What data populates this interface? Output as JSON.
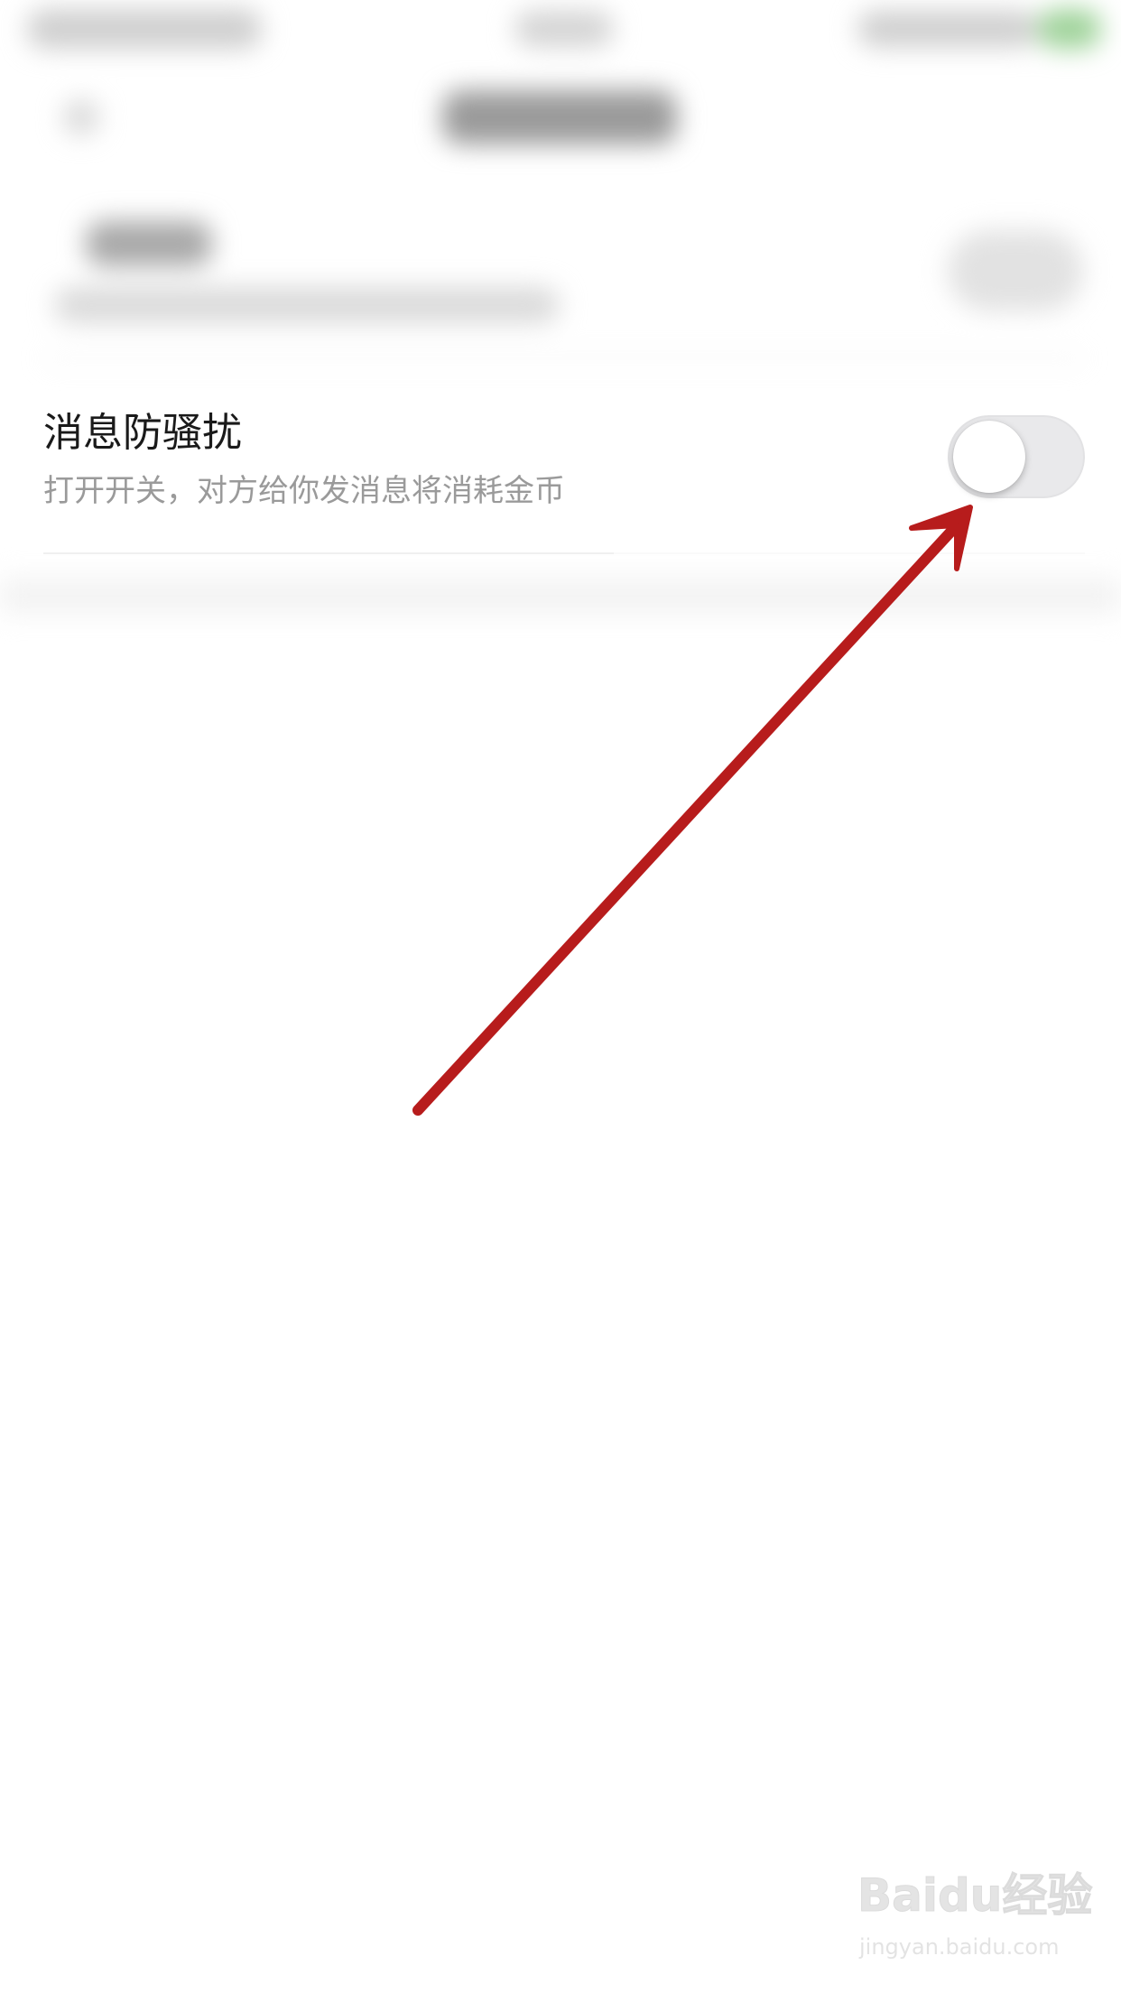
{
  "setting": {
    "title": "消息防骚扰",
    "description": "打开开关，对方给你发消息将消耗金币",
    "toggle_on": false
  },
  "colors": {
    "annotation_arrow": "#b71c1c",
    "toggle_track_off": "#e9e9eb",
    "title_text": "#1a1a1a",
    "desc_text": "#9a9a9a"
  },
  "watermark": {
    "logo": "Baidu经验",
    "url": "jingyan.baidu.com"
  }
}
